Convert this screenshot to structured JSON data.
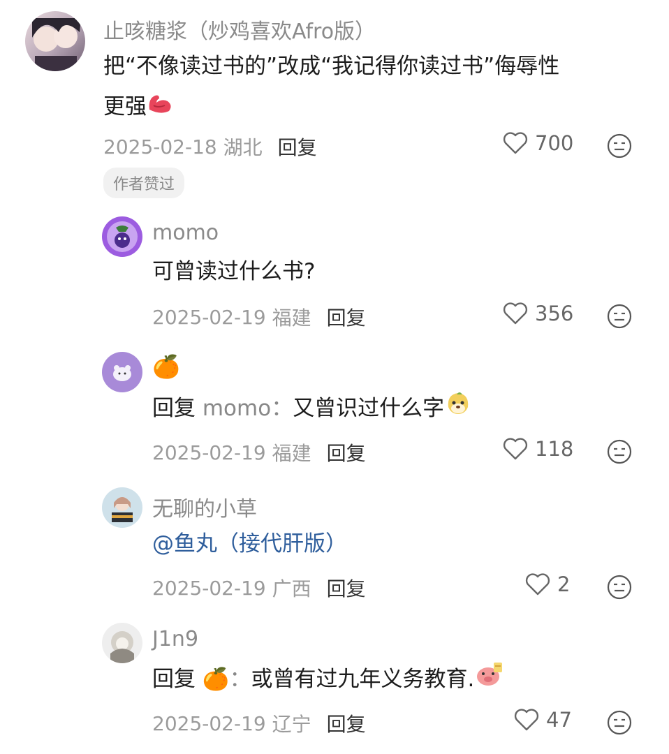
{
  "comments": [
    {
      "username": "止咳糖浆（炒鸡喜欢Afro版）",
      "text_line1": "把“不像读过书的”改成“我记得你读过书”侮辱性",
      "text_line2": "更强",
      "date": "2025-02-18",
      "location": "湖北",
      "reply_label": "回复",
      "likes": "700",
      "badge": "作者赞过"
    },
    {
      "username": "momo",
      "text": "可曾读过什么书?",
      "date": "2025-02-19",
      "location": "福建",
      "reply_label": "回复",
      "likes": "356"
    },
    {
      "username": "🍊",
      "reply_prefix": "回复",
      "reply_to": "momo：",
      "text": "又曾识过什么字",
      "date": "2025-02-19",
      "location": "福建",
      "reply_label": "回复",
      "likes": "118"
    },
    {
      "username": "无聊的小草",
      "text": "@鱼丸（接代肝版）",
      "date": "2025-02-19",
      "location": "广西",
      "reply_label": "回复",
      "likes": "2"
    },
    {
      "username": "J1n9",
      "reply_prefix": "回复",
      "reply_to": "🍊：",
      "text": "或曾有过九年义务教育.",
      "date": "2025-02-19",
      "location": "辽宁",
      "reply_label": "回复",
      "likes": "47"
    }
  ],
  "icons": {
    "like": "heart-outline-icon",
    "dislike": "neutral-face-icon"
  },
  "colors": {
    "link": "#2f5e9c",
    "meta": "#9b9b9b",
    "username": "#8a8a8a"
  }
}
